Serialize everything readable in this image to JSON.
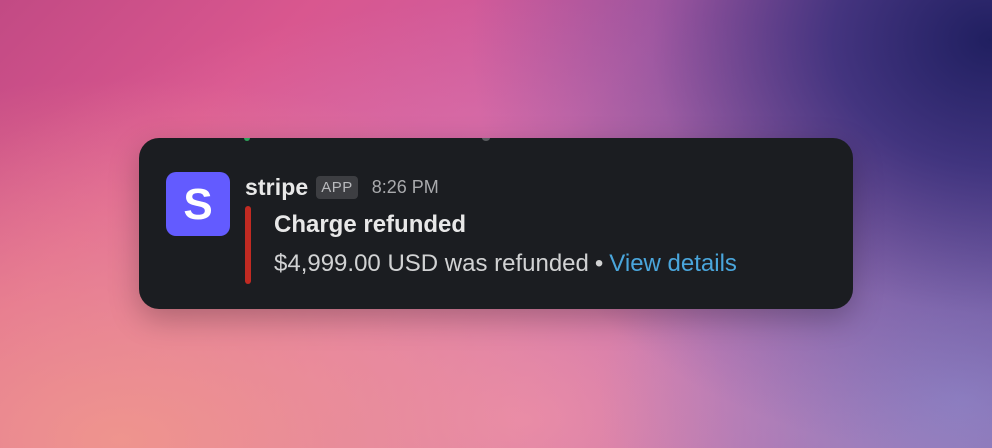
{
  "message": {
    "app_name": "stripe",
    "app_badge": "APP",
    "timestamp": "8:26 PM",
    "avatar_letter": "S",
    "avatar_color": "#635bff",
    "accent_color": "#c12a22",
    "attachment": {
      "title": "Charge refunded",
      "text": "$4,999.00 USD was refunded",
      "separator": "•",
      "link_label": "View details",
      "link_color": "#4aa6dc"
    }
  }
}
